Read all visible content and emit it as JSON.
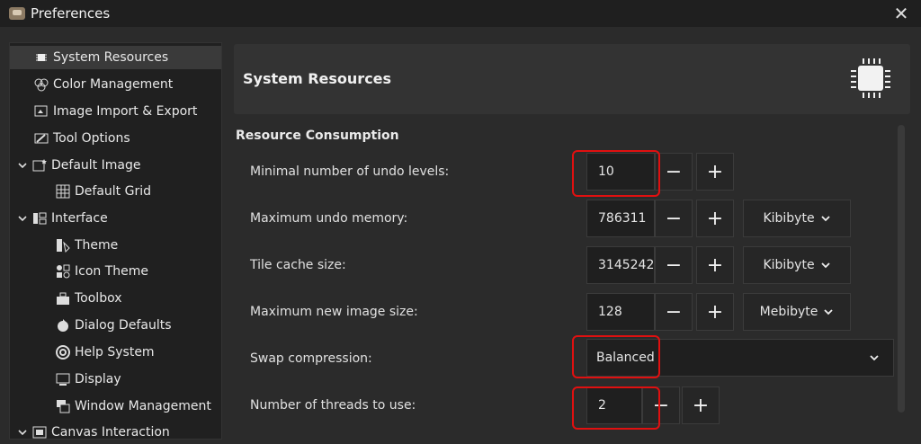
{
  "window": {
    "title": "Preferences"
  },
  "sidebar": {
    "items": [
      {
        "label": "System Resources"
      },
      {
        "label": "Color Management"
      },
      {
        "label": "Image Import & Export"
      },
      {
        "label": "Tool Options"
      },
      {
        "label": "Default Image"
      },
      {
        "label": "Default Grid"
      },
      {
        "label": "Interface"
      },
      {
        "label": "Theme"
      },
      {
        "label": "Icon Theme"
      },
      {
        "label": "Toolbox"
      },
      {
        "label": "Dialog Defaults"
      },
      {
        "label": "Help System"
      },
      {
        "label": "Display"
      },
      {
        "label": "Window Management"
      },
      {
        "label": "Canvas Interaction"
      }
    ]
  },
  "main": {
    "header_title": "System Resources",
    "section_title": "Resource Consumption",
    "rows": {
      "undo_levels": {
        "label": "Minimal number of undo levels:",
        "value": "10"
      },
      "undo_memory": {
        "label": "Maximum undo memory:",
        "value": "786311",
        "unit": "Kibibyte"
      },
      "tile_cache": {
        "label": "Tile cache size:",
        "value": "3145242",
        "unit": "Kibibyte"
      },
      "max_image": {
        "label": "Maximum new image size:",
        "value": "128",
        "unit": "Mebibyte"
      },
      "swap": {
        "label": "Swap compression:",
        "value": "Balanced"
      },
      "threads": {
        "label": "Number of threads to use:",
        "value": "2"
      }
    },
    "buttons": {
      "minus": "−",
      "plus": "+"
    }
  }
}
